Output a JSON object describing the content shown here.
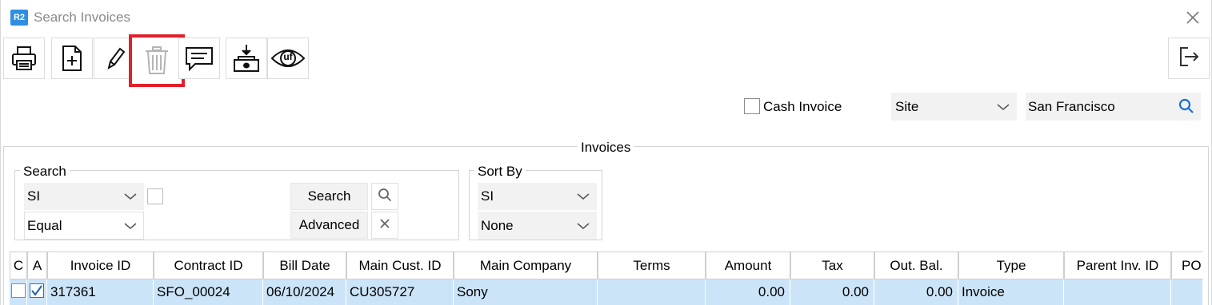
{
  "window": {
    "app_badge": "R2",
    "title": "Search Invoices"
  },
  "toolbar": {
    "buttons": [
      {
        "name": "print-button",
        "icon": "printer-icon"
      },
      {
        "name": "new-invoice-button",
        "icon": "new-document-icon"
      },
      {
        "name": "edit-button",
        "icon": "pencil-icon"
      },
      {
        "name": "delete-button",
        "icon": "trash-icon",
        "disabled": true,
        "highlighted": true
      },
      {
        "name": "comment-button",
        "icon": "comment-icon"
      },
      {
        "name": "download-button",
        "icon": "download-tray-icon"
      },
      {
        "name": "uf-view-button",
        "icon": "uf-eye-icon"
      }
    ],
    "uf_label": "uf",
    "exit_icon": "exit-icon"
  },
  "filters": {
    "cash_invoice_label": "Cash Invoice",
    "cash_invoice_checked": false,
    "scope_select": "Site",
    "scope_value": "San Francisco"
  },
  "invoices_group": {
    "title": "Invoices",
    "search": {
      "title": "Search",
      "field_select": "SI",
      "operator_select": "Equal",
      "search_button": "Search",
      "advanced_button": "Advanced"
    },
    "sort": {
      "title": "Sort By",
      "primary": "SI",
      "secondary": "None"
    }
  },
  "grid": {
    "columns": [
      "C",
      "A",
      "Invoice ID",
      "Contract ID",
      "Bill Date",
      "Main Cust. ID",
      "Main Company",
      "Terms",
      "Amount",
      "Tax",
      "Out. Bal.",
      "Type",
      "Parent Inv. ID",
      "PO"
    ],
    "rows": [
      {
        "c_checked": false,
        "a_checked": true,
        "invoice_id": "317361",
        "contract_id": "SFO_00024",
        "bill_date": "06/10/2024",
        "main_cust_id": "CU305727",
        "main_company": "Sony",
        "terms": "",
        "amount": "0.00",
        "tax": "0.00",
        "out_bal": "0.00",
        "type": "Invoice",
        "parent_inv_id": "",
        "po": ""
      }
    ]
  },
  "colors": {
    "highlight": "#e0202a",
    "selected_row": "#cce4f7",
    "accent": "#2f8fe0"
  }
}
